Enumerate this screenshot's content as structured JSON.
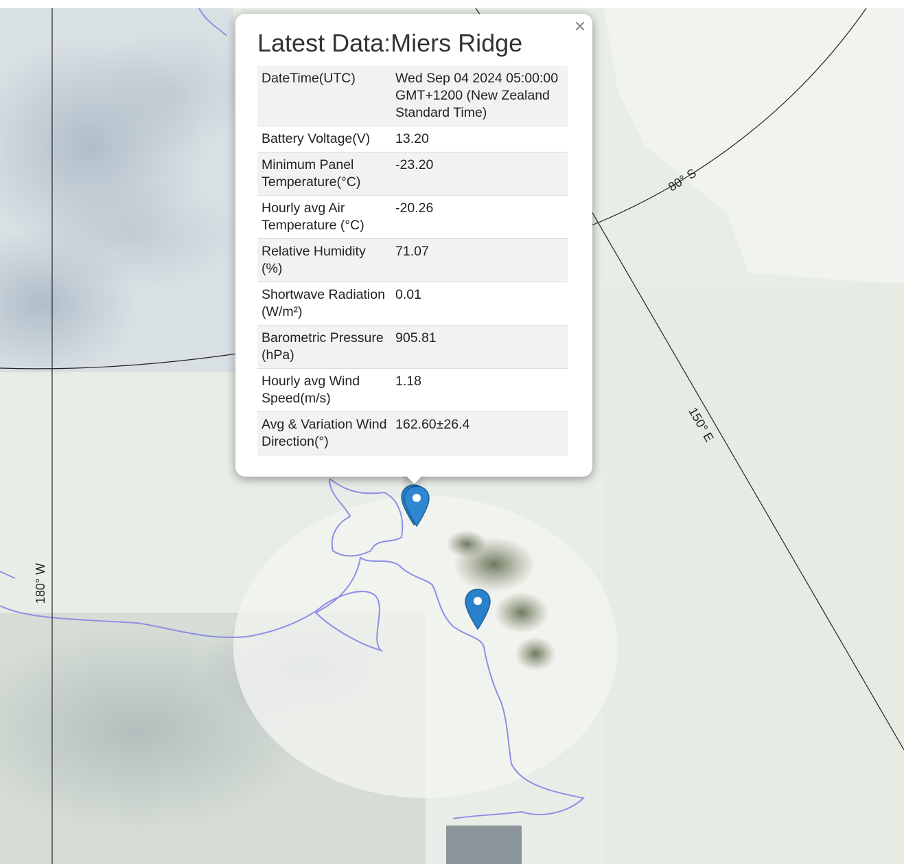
{
  "popup": {
    "title": "Latest Data:Miers Ridge",
    "close_symbol": "×",
    "rows": [
      {
        "label": "DateTime(UTC)",
        "value": "Wed Sep 04 2024 05:00:00 GMT+1200 (New Zealand Standard Time)"
      },
      {
        "label": "Battery Voltage(V)",
        "value": "13.20"
      },
      {
        "label": "Minimum Panel Temperature(°C)",
        "value": "-23.20"
      },
      {
        "label": "Hourly avg Air Temperature (°C)",
        "value": "-20.26"
      },
      {
        "label": "Relative Humidity (%)",
        "value": "71.07"
      },
      {
        "label": "Shortwave Radiation (W/m²)",
        "value": "0.01"
      },
      {
        "label": "Barometric Pressure (hPa)",
        "value": "905.81"
      },
      {
        "label": "Hourly avg Wind Speed(m/s)",
        "value": "1.18"
      },
      {
        "label": "Avg & Variation Wind Direction(°)",
        "value": "162.60±26.4"
      }
    ]
  },
  "map": {
    "graticule_labels": {
      "lat": "80° S",
      "lon_east": "150° E",
      "lon_west": "180° W"
    },
    "markers": [
      {
        "name": "station-marker-1",
        "icon": "map-pin-icon"
      },
      {
        "name": "station-marker-2",
        "icon": "map-pin-icon"
      }
    ],
    "colors": {
      "marker": "#2a81cb",
      "coastline": "#8e8ee6",
      "graticule": "#222222"
    }
  }
}
